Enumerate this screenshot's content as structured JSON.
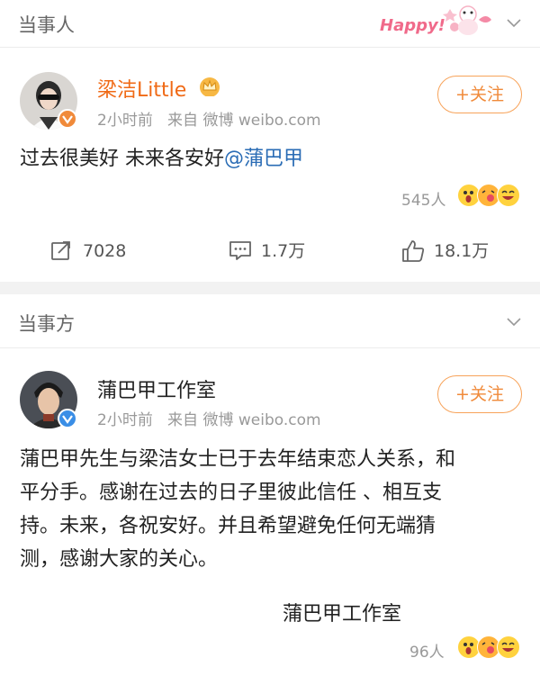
{
  "section1": {
    "title": "当事人",
    "sticker_text": "Happy!"
  },
  "post1": {
    "user_name": "梁洁Little",
    "time": "2小时前",
    "source": "来自 微博 weibo.com",
    "follow_label": "+关注",
    "text": "过去很美好 未来各安好",
    "mention": "@蒲巴甲",
    "reactions_count": "545人",
    "reposts": "7028",
    "comments": "1.7万",
    "likes": "18.1万"
  },
  "section2": {
    "title": "当事方"
  },
  "post2": {
    "user_name": "蒲巴甲工作室",
    "time": "2小时前",
    "source": "来自 微博 weibo.com",
    "follow_label": "+关注",
    "lines": [
      "蒲巴甲先生与梁洁女士已于去年结束恋人关系，和",
      "平分手。感谢在过去的日子里彼此信任 、相互支",
      "持。未来，各祝安好。并且希望避免任何无端猜",
      "测，感谢大家的关心。"
    ],
    "signature": "蒲巴甲工作室",
    "reactions_count": "96人"
  },
  "colors": {
    "accent": "#f08a3a",
    "mention": "#2a6cb5",
    "meta": "#999999",
    "gap": "#f2f2f2"
  }
}
